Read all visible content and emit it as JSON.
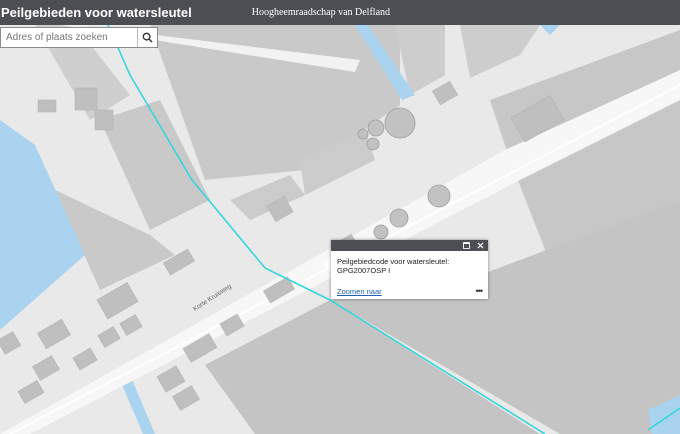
{
  "header": {
    "title": "Peilgebieden voor watersleutel",
    "organization": "Hoogheemraadschap van Delfland"
  },
  "search": {
    "placeholder": "Adres of plaats zoeken",
    "icon": "search-icon"
  },
  "popup": {
    "label": "Peilgebiedcode voor watersleutel:",
    "value": "GPG2007OSP I",
    "zoom_link": "Zoomen naar",
    "more_icon": "•••",
    "icons": [
      "maximize-icon",
      "close-icon"
    ]
  },
  "map": {
    "street_label": "Korte Kruisweg",
    "colors": {
      "background": "#e9e9e9",
      "road": "#f7f7f7",
      "building": "#c9c9c9",
      "water": "#aad3f0",
      "boundary": "#36d6dd",
      "header": "#4c4e53"
    }
  }
}
